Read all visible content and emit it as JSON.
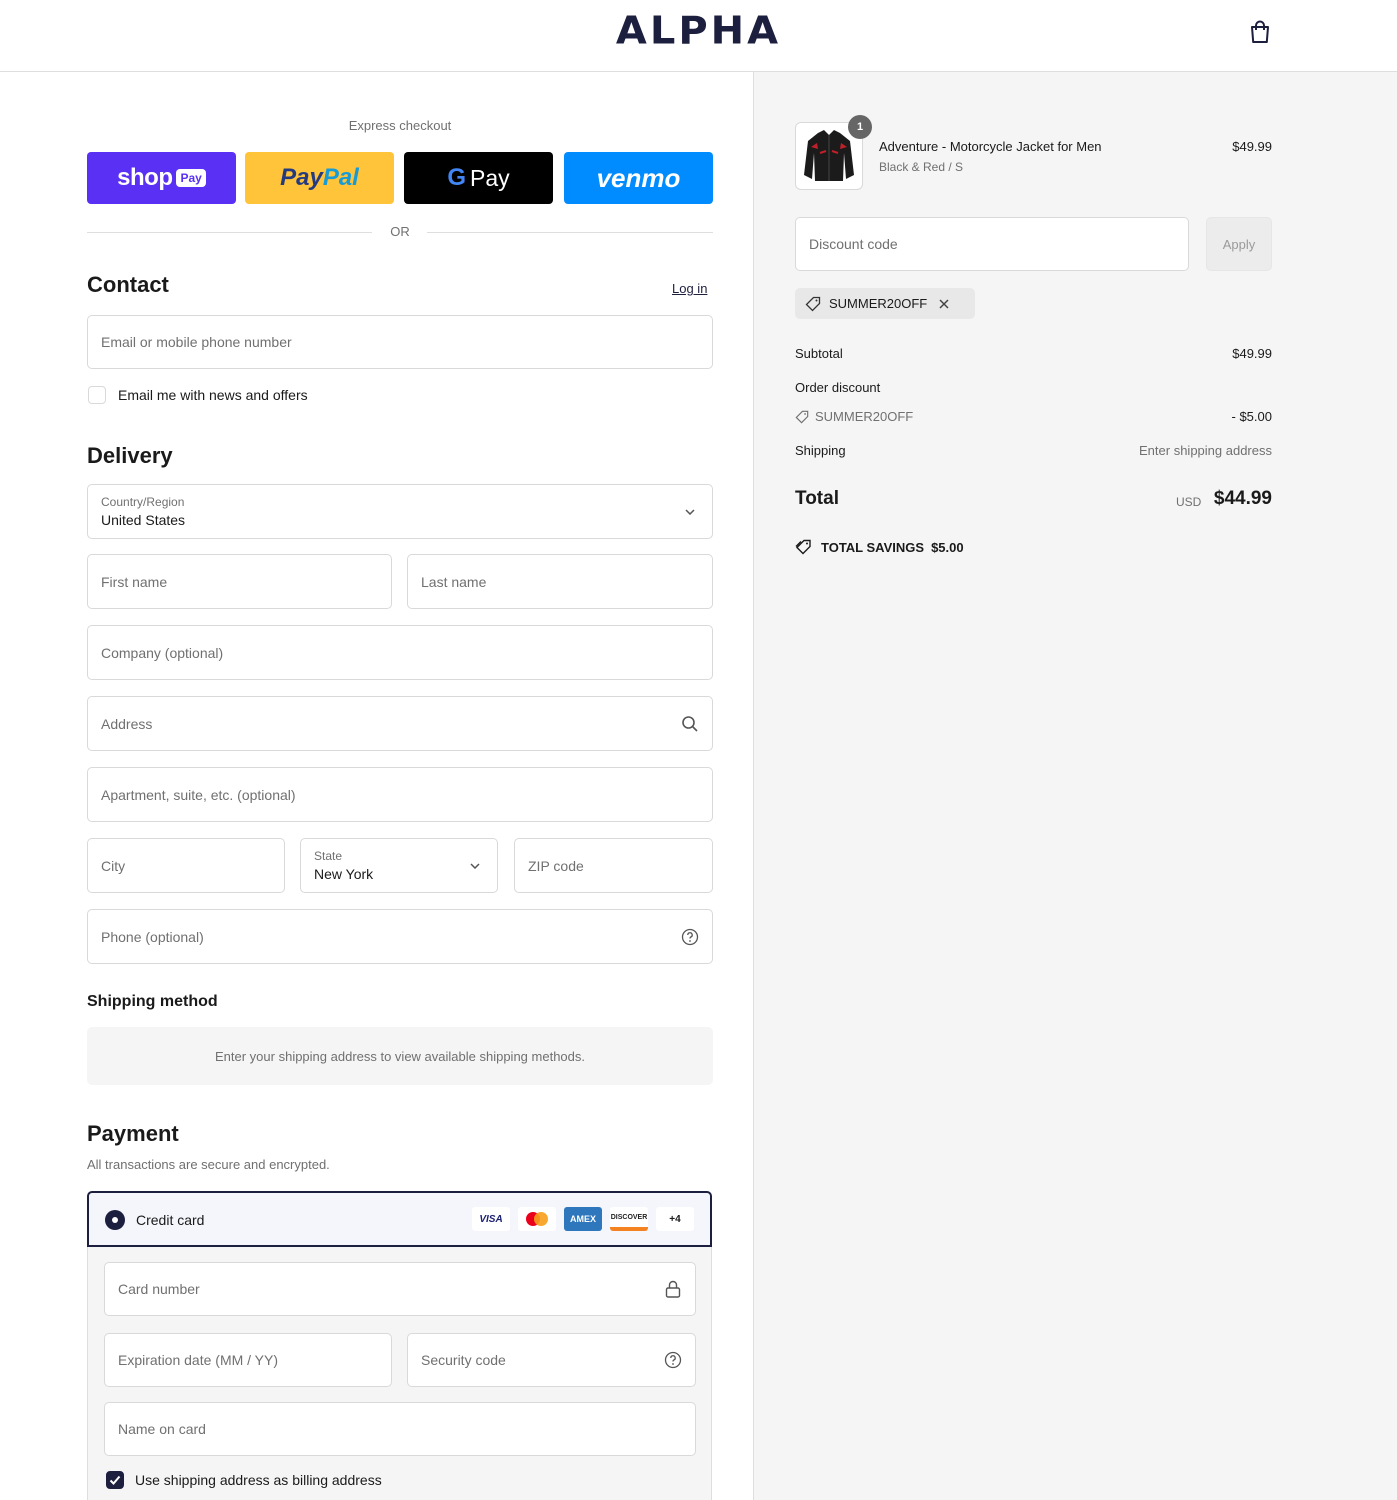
{
  "header": {
    "logo": "ALPHA",
    "cart_icon": "bag-icon"
  },
  "express": {
    "label": "Express checkout",
    "shop_pay": {
      "name": "shop",
      "badge": "Pay"
    },
    "paypal": {
      "part1": "Pay",
      "part2": "Pal"
    },
    "gpay": {
      "g": "G",
      "label": "Pay"
    },
    "venmo": {
      "label": "venmo"
    },
    "or": "OR"
  },
  "contact": {
    "title": "Contact",
    "login_link": "Log in",
    "email_placeholder": "Email or mobile phone number",
    "newsletter_label": "Email me with news and offers",
    "newsletter_checked": false
  },
  "delivery": {
    "title": "Delivery",
    "country_label": "Country/Region",
    "country_value": "United States",
    "first_name": "First name",
    "last_name": "Last name",
    "company": "Company (optional)",
    "address": "Address",
    "apartment": "Apartment, suite, etc. (optional)",
    "city": "City",
    "state_label": "State",
    "state_value": "New York",
    "zip": "ZIP code",
    "phone": "Phone (optional)"
  },
  "shipping_method": {
    "title": "Shipping method",
    "message": "Enter your shipping address to view available shipping methods."
  },
  "payment": {
    "title": "Payment",
    "subtitle": "All transactions are secure and encrypted.",
    "method_label": "Credit card",
    "brands": [
      "VISA",
      "MC",
      "AMEX",
      "DISCOVER",
      "+4"
    ],
    "card_number": "Card number",
    "expiration": "Expiration date (MM / YY)",
    "security_code": "Security code",
    "name_on_card": "Name on card",
    "billing_same_label": "Use shipping address as billing address",
    "billing_same_checked": true
  },
  "summary": {
    "item": {
      "quantity": "1",
      "name": "Adventure - Motorcycle Jacket for Men",
      "variant": "Black & Red / S",
      "price": "$49.99"
    },
    "discount_placeholder": "Discount code",
    "apply_label": "Apply",
    "applied_code": "SUMMER20OFF",
    "subtotal_label": "Subtotal",
    "subtotal_value": "$49.99",
    "order_discount_label": "Order discount",
    "order_discount_code": "SUMMER20OFF",
    "order_discount_value": "- $5.00",
    "shipping_label": "Shipping",
    "shipping_value": "Enter shipping address",
    "total_label": "Total",
    "currency": "USD",
    "total_value": "$44.99",
    "savings_label": "TOTAL SAVINGS",
    "savings_value": "$5.00"
  }
}
